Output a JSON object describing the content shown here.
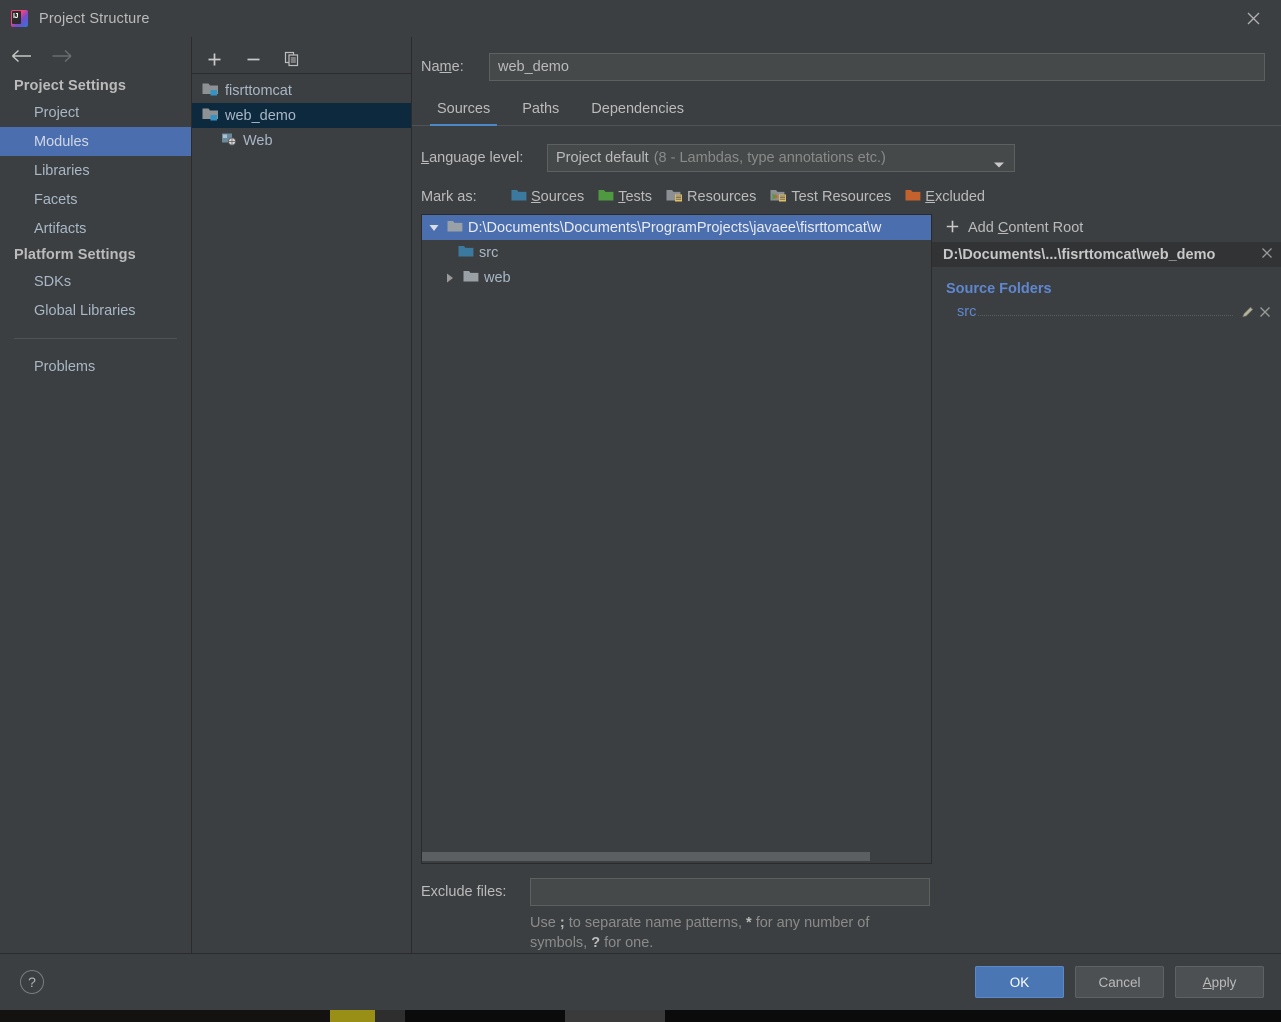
{
  "window": {
    "title": "Project Structure",
    "app_icon": "intellij-idea-icon",
    "close_icon": "close-icon"
  },
  "sidebar": {
    "back_icon": "arrow-left-icon",
    "forward_icon": "arrow-right-icon",
    "groups": [
      {
        "title": "Project Settings",
        "items": [
          {
            "label": "Project",
            "selected": false
          },
          {
            "label": "Modules",
            "selected": true
          },
          {
            "label": "Libraries",
            "selected": false
          },
          {
            "label": "Facets",
            "selected": false
          },
          {
            "label": "Artifacts",
            "selected": false
          }
        ]
      },
      {
        "title": "Platform Settings",
        "items": [
          {
            "label": "SDKs",
            "selected": false
          },
          {
            "label": "Global Libraries",
            "selected": false
          }
        ]
      }
    ],
    "problems": "Problems"
  },
  "modules_pane": {
    "toolbar": {
      "add": "+",
      "remove": "−",
      "copy_icon": "copy-icon"
    },
    "items": [
      {
        "label": "fisrttomcat",
        "icon": "module-folder-icon",
        "selected": false,
        "child": false
      },
      {
        "label": "web_demo",
        "icon": "module-folder-icon",
        "selected": true,
        "child": false
      },
      {
        "label": "Web",
        "icon": "web-facet-icon",
        "selected": false,
        "child": true
      }
    ]
  },
  "detail": {
    "name_label_pre": "Na",
    "name_label_mnemonic": "m",
    "name_label_post": "e:",
    "name_value": "web_demo",
    "tabs": [
      {
        "label": "Sources",
        "active": true
      },
      {
        "label": "Paths",
        "active": false
      },
      {
        "label": "Dependencies",
        "active": false
      }
    ],
    "language_level": {
      "label_mnemonic": "L",
      "label_rest": "anguage level:",
      "value": "Project default",
      "value_note": "(8 - Lambdas, type annotations etc.)",
      "arrow_icon": "chevron-down-icon"
    },
    "mark_as": {
      "label": "Mark as:",
      "options": [
        {
          "mnemonic": "S",
          "rest": "ources",
          "icon": "sources-folder-icon",
          "color": "#3b7a9e"
        },
        {
          "mnemonic": "T",
          "rest": "ests",
          "icon": "tests-folder-icon",
          "color": "#4f9a41"
        },
        {
          "mnemonic": "",
          "rest": "Resources",
          "icon": "resources-folder-icon",
          "color": "#8c9094"
        },
        {
          "mnemonic": "",
          "rest": "Test Resources",
          "icon": "test-resources-folder-icon",
          "color": "#8c9094"
        },
        {
          "mnemonic": "E",
          "rest": "xcluded",
          "icon": "excluded-folder-icon",
          "color": "#c4622d"
        }
      ]
    },
    "tree": [
      {
        "label": "D:\\Documents\\Documents\\ProgramProjects\\javaee\\fisrttomcat\\w",
        "icon": "content-root-folder-icon",
        "indent": 0,
        "twisty": "expanded",
        "selected": true
      },
      {
        "label": "src",
        "icon": "sources-folder-icon",
        "indent": 1,
        "twisty": "none",
        "selected": false
      },
      {
        "label": "web",
        "icon": "plain-folder-icon",
        "indent": 1,
        "twisty": "collapsed",
        "selected": false
      }
    ],
    "exclude": {
      "label": "Exclude files:",
      "value": "",
      "hint_a": "Use ",
      "hint_semi": ";",
      "hint_b": " to separate name patterns, ",
      "hint_star": "*",
      "hint_c": " for any number of symbols, ",
      "hint_q": "?",
      "hint_d": " for one."
    }
  },
  "right_panel": {
    "add_content_root": {
      "plus": "+",
      "pre": "Add ",
      "mnemonic": "C",
      "post": "ontent Root"
    },
    "content_root": {
      "path": "D:\\Documents\\...\\fisrttomcat\\web_demo",
      "remove_icon": "close-icon"
    },
    "source_folders_header": "Source Folders",
    "source_folders": [
      {
        "name": "src",
        "edit_icon": "pencil-icon",
        "remove_icon": "close-icon"
      }
    ]
  },
  "footer": {
    "help_icon": "help-icon",
    "help_label": "?",
    "buttons": [
      {
        "label": "OK",
        "primary": true,
        "mnemonic": ""
      },
      {
        "label": "Cancel",
        "primary": false,
        "mnemonic": ""
      },
      {
        "label": "Apply",
        "primary": false,
        "mnemonic": "A"
      }
    ]
  },
  "colors": {
    "background": "#3c3f41",
    "selection": "#4b6eaf",
    "inactive_selection": "#0d293e",
    "accent_link": "#5f87d0",
    "tab_underline": "#4a88c7",
    "primary_button": "#4a77b3",
    "text": "#bbbbbb",
    "tree_text": "#a9b7c6"
  }
}
